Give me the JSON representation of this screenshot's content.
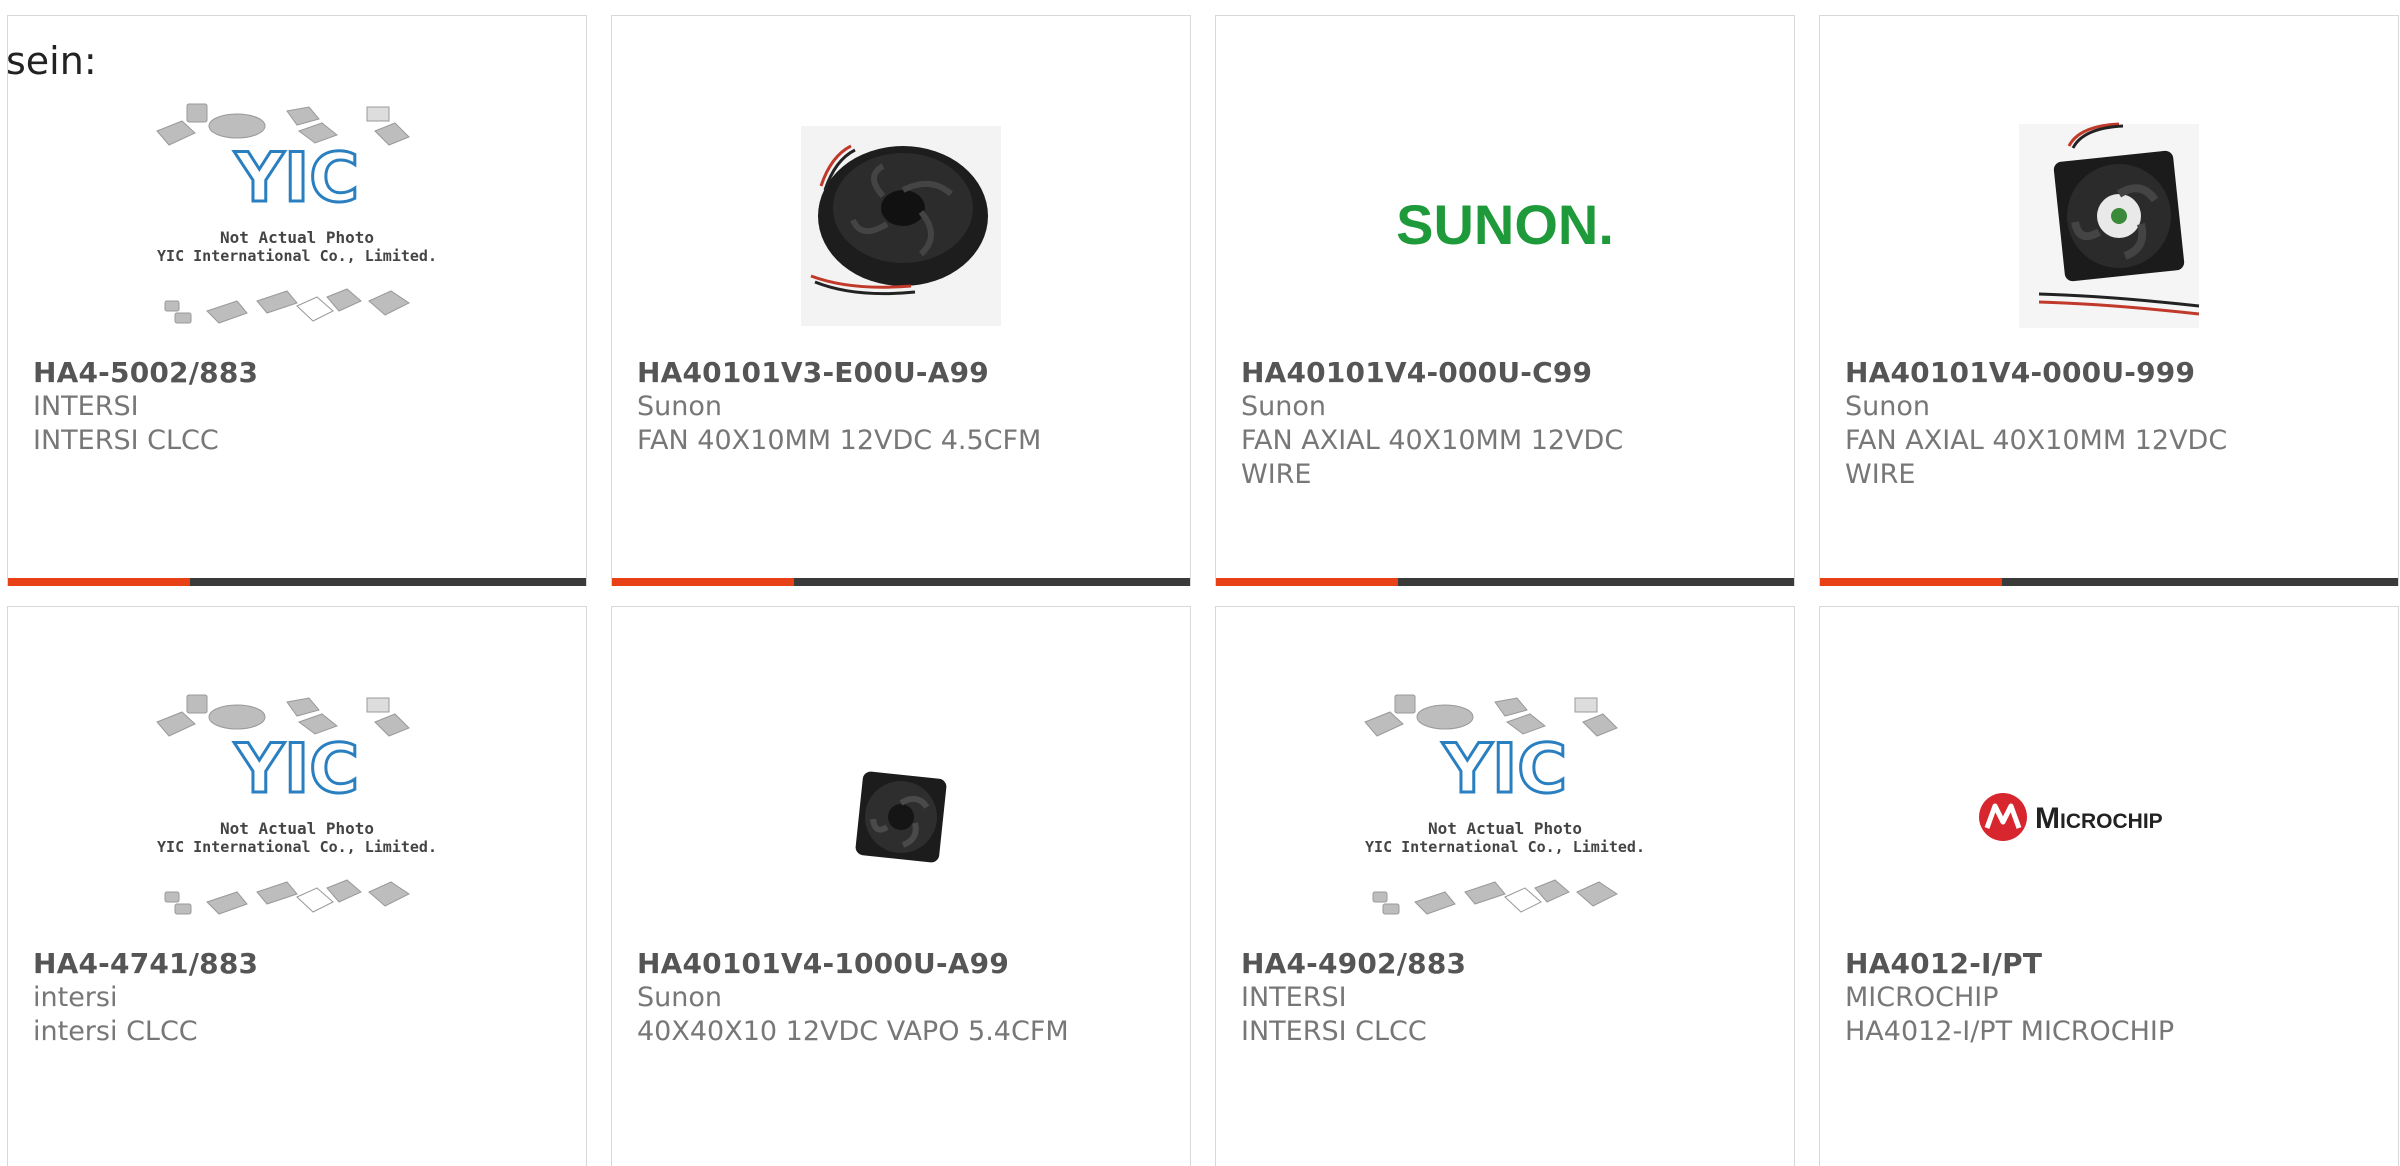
{
  "lead_text": "sein:",
  "colors": {
    "accent": "#e84118",
    "bar": "#3a3a3a",
    "sunon_green": "#1e9a3a",
    "microchip_red": "#d7262e",
    "yic_blue": "#2a7fc0"
  },
  "yic_placeholder": {
    "line1": "Not Actual Photo",
    "line2": "YIC International Co., Limited.",
    "logo": "YIC"
  },
  "products": [
    {
      "part": "HA4-5002/883",
      "maker": "INTERSI",
      "desc": "INTERSI CLCC",
      "image": "yic-placeholder"
    },
    {
      "part": "HA40101V3-E00U-A99",
      "maker": "Sunon",
      "desc": "FAN 40X10MM 12VDC 4.5CFM",
      "image": "round-fan-photo"
    },
    {
      "part": "HA40101V4-000U-C99",
      "maker": "Sunon",
      "desc": "FAN AXIAL 40X10MM 12VDC\nWIRE",
      "image": "sunon-logo",
      "logo_text": "SUNON."
    },
    {
      "part": "HA40101V4-000U-999",
      "maker": "Sunon",
      "desc": "FAN AXIAL 40X10MM 12VDC\nWIRE",
      "image": "square-fan-photo"
    },
    {
      "part": "HA4-4741/883",
      "maker": "intersi",
      "desc": "intersi CLCC",
      "image": "yic-placeholder"
    },
    {
      "part": "HA40101V4-1000U-A99",
      "maker": "Sunon",
      "desc": "40X40X10 12VDC VAPO 5.4CFM",
      "image": "small-fan-photo"
    },
    {
      "part": "HA4-4902/883",
      "maker": "INTERSI",
      "desc": "INTERSI CLCC",
      "image": "yic-placeholder"
    },
    {
      "part": "HA4012-I/PT",
      "maker": "MICROCHIP",
      "desc": "HA4012-I/PT MICROCHIP",
      "image": "microchip-logo",
      "logo_text": "Microchip"
    }
  ]
}
